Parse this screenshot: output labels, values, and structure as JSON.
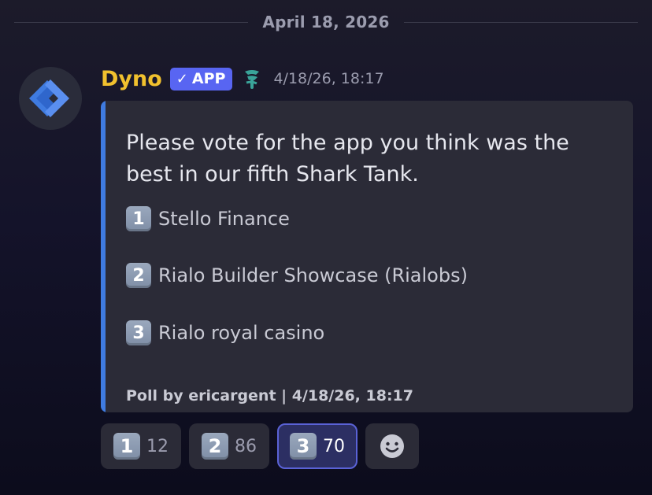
{
  "date_divider": "April 18, 2026",
  "message": {
    "author": "Dyno",
    "badge": "APP",
    "badge_check": "✓",
    "role_icon": "role-icon",
    "timestamp": "4/18/26, 18:17",
    "avatar_icon": "dyno-logo",
    "colors": {
      "username": "#f1c12e",
      "badge": "#5865f2",
      "embed_accent": "#3f7be0"
    }
  },
  "embed": {
    "description": "Please vote for the app you think was the best in our fifth Shark Tank.",
    "options": [
      {
        "key": "1",
        "label": "Stello Finance"
      },
      {
        "key": "2",
        "label": "Rialo Builder Showcase (Rialobs)"
      },
      {
        "key": "3",
        "label": "Rialo royal casino"
      }
    ],
    "footer": "Poll by ericargent | 4/18/26, 18:17"
  },
  "reactions": [
    {
      "emoji": "1",
      "count": "12",
      "active": false
    },
    {
      "emoji": "2",
      "count": "86",
      "active": false
    },
    {
      "emoji": "3",
      "count": "70",
      "active": true
    }
  ],
  "add_reaction_icon": "smiley-add-reaction-icon"
}
